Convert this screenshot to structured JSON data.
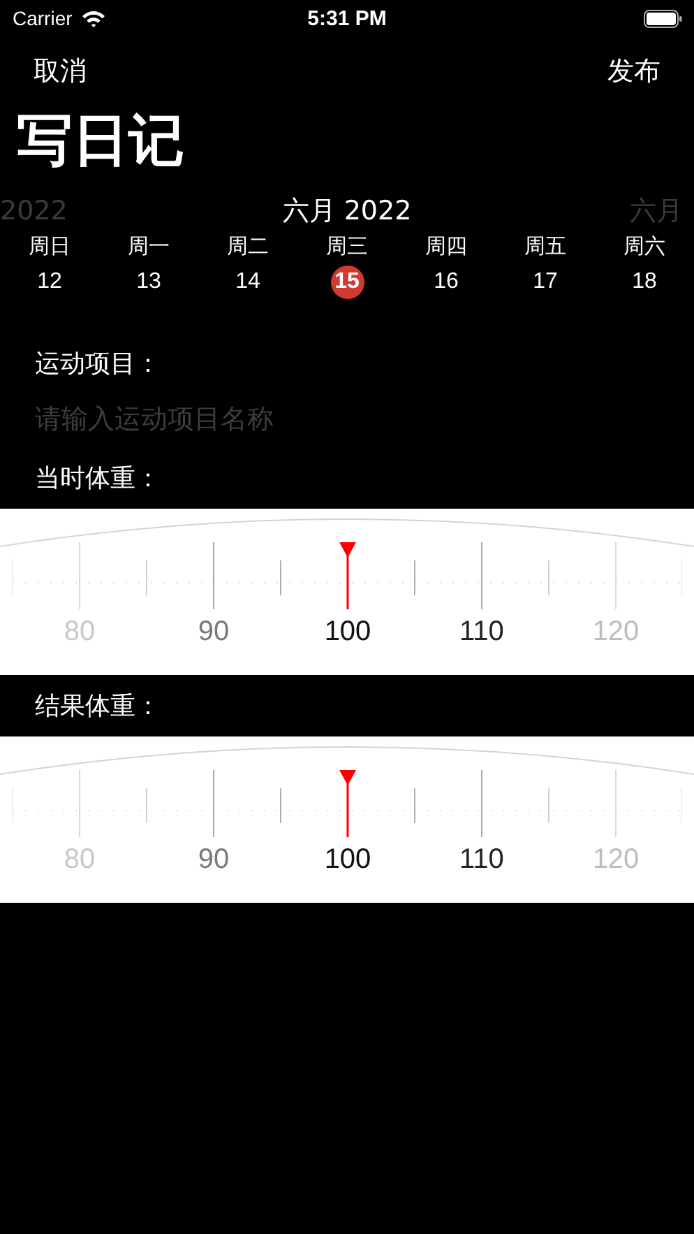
{
  "status_bar": {
    "carrier": "Carrier",
    "time": "5:31 PM"
  },
  "nav": {
    "cancel": "取消",
    "publish": "发布"
  },
  "title": "写日记",
  "calendar": {
    "prev_label": "2022",
    "month": "六月 2022",
    "next_label": "六月",
    "days": [
      {
        "weekday": "周日",
        "date": "12",
        "selected": false
      },
      {
        "weekday": "周一",
        "date": "13",
        "selected": false
      },
      {
        "weekday": "周二",
        "date": "14",
        "selected": false
      },
      {
        "weekday": "周三",
        "date": "15",
        "selected": true
      },
      {
        "weekday": "周四",
        "date": "16",
        "selected": false
      },
      {
        "weekday": "周五",
        "date": "17",
        "selected": false
      },
      {
        "weekday": "周六",
        "date": "18",
        "selected": false
      }
    ]
  },
  "exercise": {
    "label": "运动项目：",
    "placeholder": "请输入运动项目名称"
  },
  "rulers": [
    {
      "label": "当时体重：",
      "ticks": [
        "80",
        "90",
        "100",
        "110",
        "120"
      ]
    },
    {
      "label": "结果体重：",
      "ticks": [
        "80",
        "90",
        "100",
        "110",
        "120"
      ]
    }
  ]
}
